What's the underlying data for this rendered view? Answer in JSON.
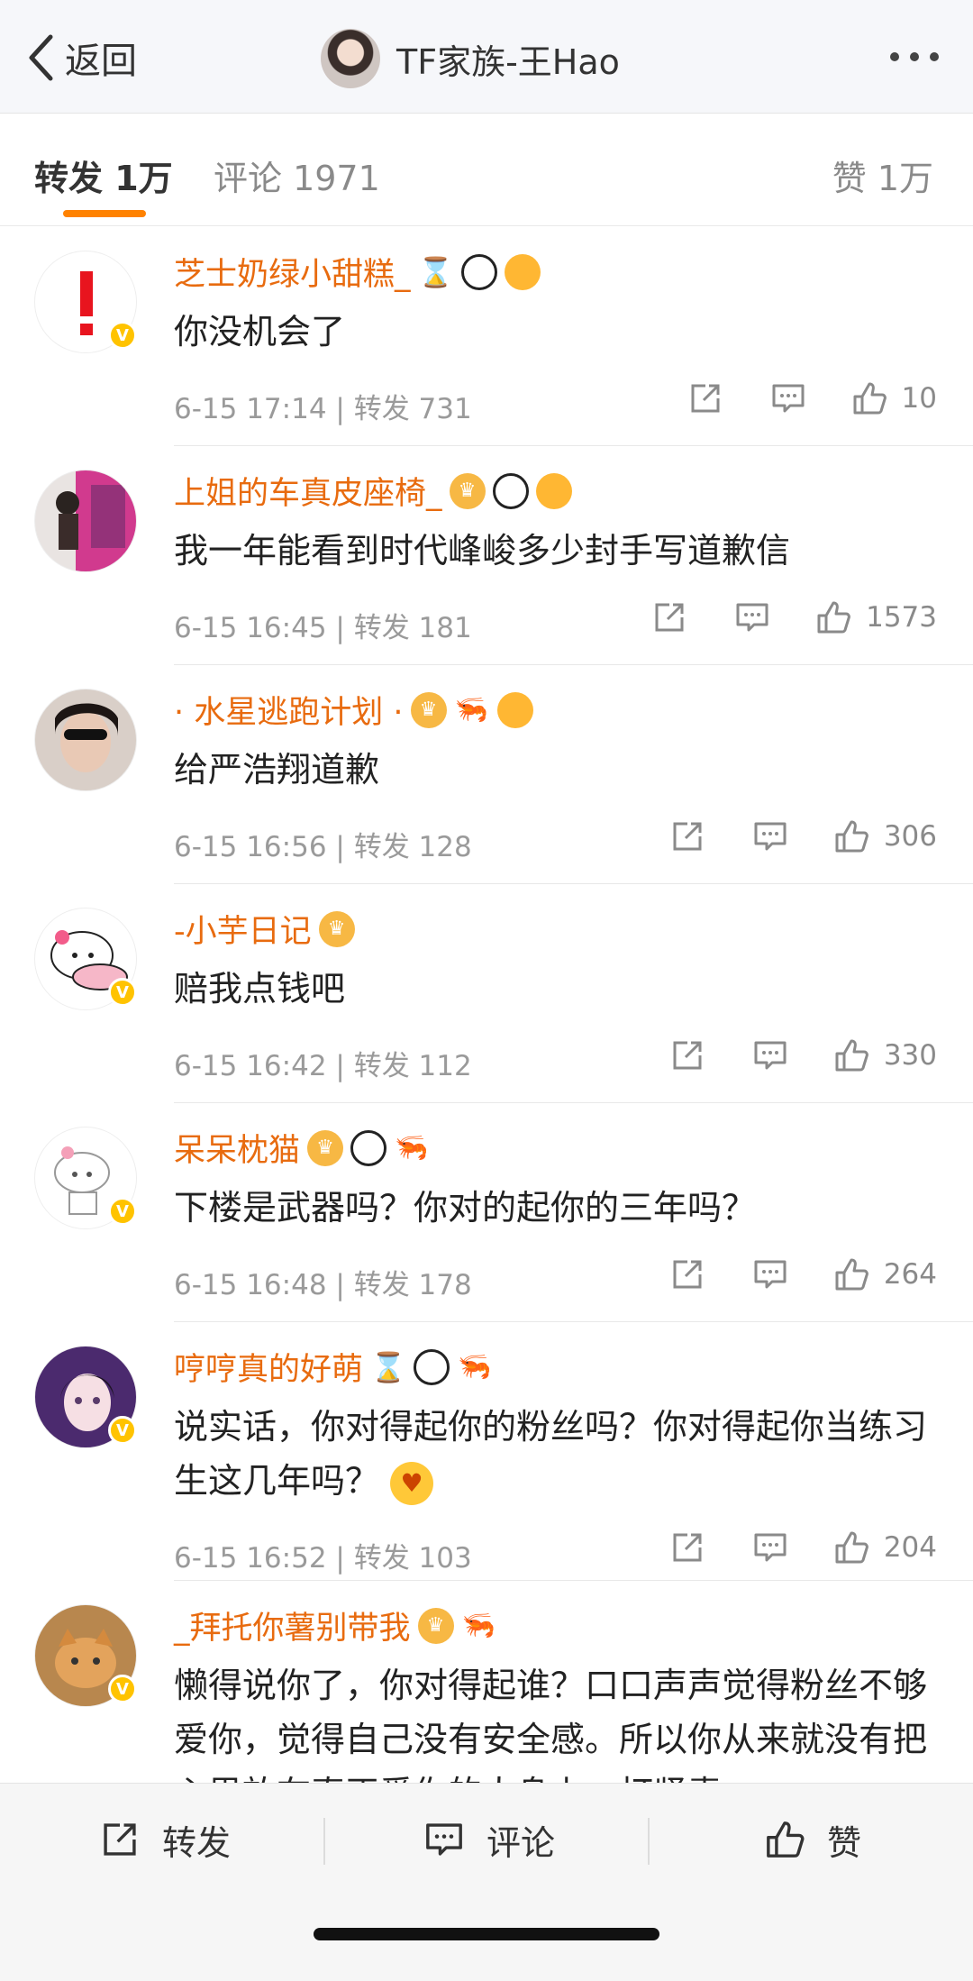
{
  "header": {
    "back_label": "返回",
    "title": "TF家族-王Hao",
    "avatar_icon": "user-avatar"
  },
  "tabs": {
    "repost": "转发 1万",
    "comments": "评论 1971",
    "likes": "赞 1万",
    "active": "repost"
  },
  "colors": {
    "accent": "#ff8200",
    "username": "#e86b0f",
    "verified": "#ffc300"
  },
  "comments": [
    {
      "user": "芝士奶绿小甜糕_",
      "text": "你没机会了",
      "time": "6-15 17:14",
      "reposts": "转发 731",
      "likes": "10",
      "verified": true,
      "badges": [
        "hourglass-icon",
        "panda-icon",
        "fish-icon"
      ]
    },
    {
      "user": "上姐的车真皮座椅_",
      "text": "我一年能看到时代峰峻多少封手写道歉信",
      "time": "6-15 16:45",
      "reposts": "转发 181",
      "likes": "1573",
      "verified": false,
      "badges": [
        "crown-icon",
        "panda-icon",
        "fish-icon"
      ]
    },
    {
      "user": "· 水星逃跑计划 ·",
      "text": "给严浩翔道歉",
      "time": "6-15 16:56",
      "reposts": "转发 128",
      "likes": "306",
      "verified": false,
      "badges": [
        "crown-icon",
        "shrimp-icon",
        "fish-icon"
      ]
    },
    {
      "user": "-小芋日记",
      "text": "赔我点钱吧",
      "time": "6-15 16:42",
      "reposts": "转发 112",
      "likes": "330",
      "verified": true,
      "badges": [
        "crown-icon"
      ]
    },
    {
      "user": "呆呆枕猫",
      "text": "下楼是武器吗？你对的起你的三年吗？",
      "time": "6-15 16:48",
      "reposts": "转发 178",
      "likes": "264",
      "verified": true,
      "badges": [
        "crown-icon",
        "panda-icon",
        "shrimp-icon"
      ]
    },
    {
      "user": "哼哼真的好萌",
      "text": "说实话，你对得起你的粉丝吗？你对得起你当练习生这几年吗？",
      "time": "6-15 16:52",
      "reposts": "转发 103",
      "likes": "204",
      "verified": true,
      "badges": [
        "hourglass-icon",
        "panda-icon",
        "shrimp-icon"
      ]
    },
    {
      "user": "_拜托你薯别带我",
      "text": "懒得说你了，你对得起谁？口口声声觉得粉丝不够爱你，觉得自己没有安全感。所以你从来就没有把心思放在真正爱你的人身上，打紧责",
      "verified": true,
      "badges": [
        "crown-icon",
        "shrimp-icon"
      ]
    }
  ],
  "bottom_bar": {
    "repost": "转发",
    "comment": "评论",
    "like": "赞"
  }
}
